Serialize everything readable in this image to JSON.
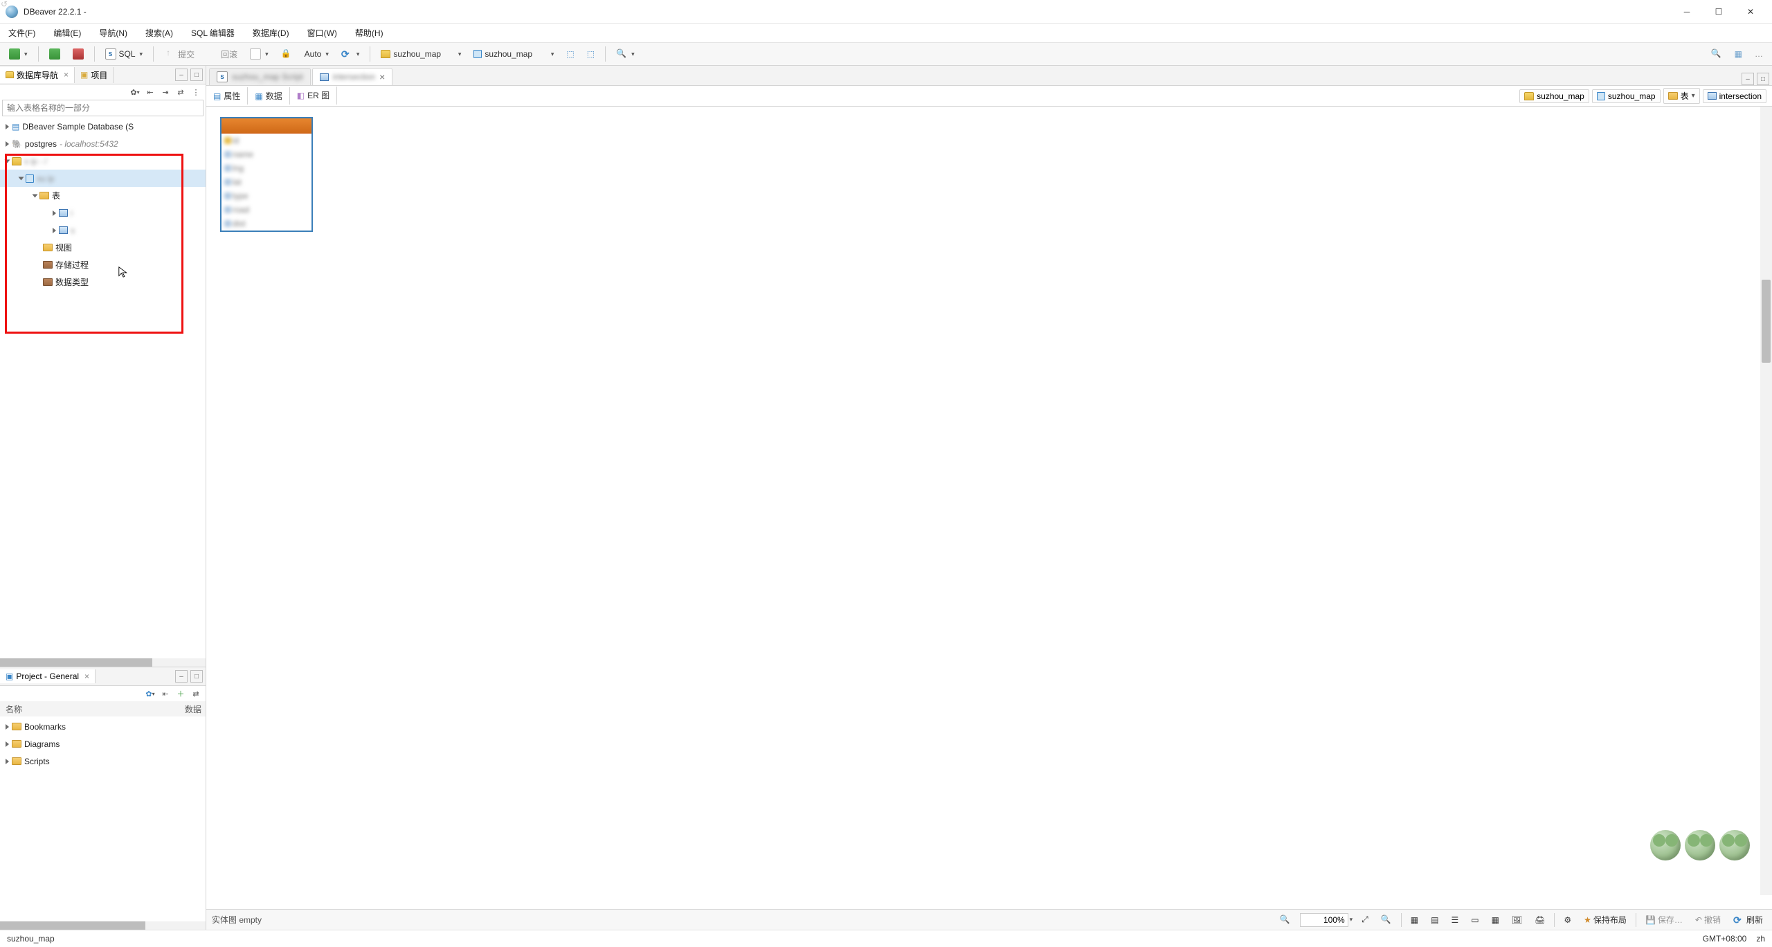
{
  "title": "DBeaver 22.2.1 - ",
  "menu": {
    "file": "文件(F)",
    "edit": "编辑(E)",
    "nav": "导航(N)",
    "search": "搜索(A)",
    "sqleditor": "SQL 编辑器",
    "database": "数据库(D)",
    "window": "窗口(W)",
    "help": "帮助(H)"
  },
  "toolbar": {
    "sql": "SQL",
    "commit": "提交",
    "rollback": "回滚",
    "auto": "Auto",
    "db_label": "suzhou_map",
    "schema_label": "suzhou_map"
  },
  "navpanel": {
    "tab_nav": "数据库导航",
    "tab_project": "项目",
    "filter_placeholder": "输入表格名称的一部分",
    "items": {
      "sample": "DBeaver Sample Database (S",
      "postgres": "postgres",
      "postgres_host": " - localhost:5432",
      "conn3": "s            ip  - /",
      "conn3db": "su          ip",
      "tables": "表",
      "tbl1": "i",
      "tbl2": "s",
      "views": "视图",
      "procs": "存储过程",
      "types": "数据类型"
    }
  },
  "project": {
    "title": "Project - General",
    "col_name": "名称",
    "col_data": "数据",
    "bookmarks": "Bookmarks",
    "diagrams": "Diagrams",
    "scripts": "Scripts"
  },
  "editor": {
    "tab1": "suzhou_map  Script",
    "tab2": "intersection",
    "sub_attr": "属性",
    "sub_data": "数据",
    "sub_er": "ER 图",
    "bc_db": "suzhou_map",
    "bc_schema": "suzhou_map",
    "bc_tables": "表",
    "bc_table": "intersection"
  },
  "bottombar": {
    "entity_label": "实体图 empty",
    "zoom": "100%",
    "keep_layout": "保持布局",
    "save": "保存…",
    "revert": "撤销",
    "refresh": "刷新"
  },
  "status": {
    "path": "suzhou_map",
    "tz": "GMT+08:00",
    "lang": "zh"
  }
}
